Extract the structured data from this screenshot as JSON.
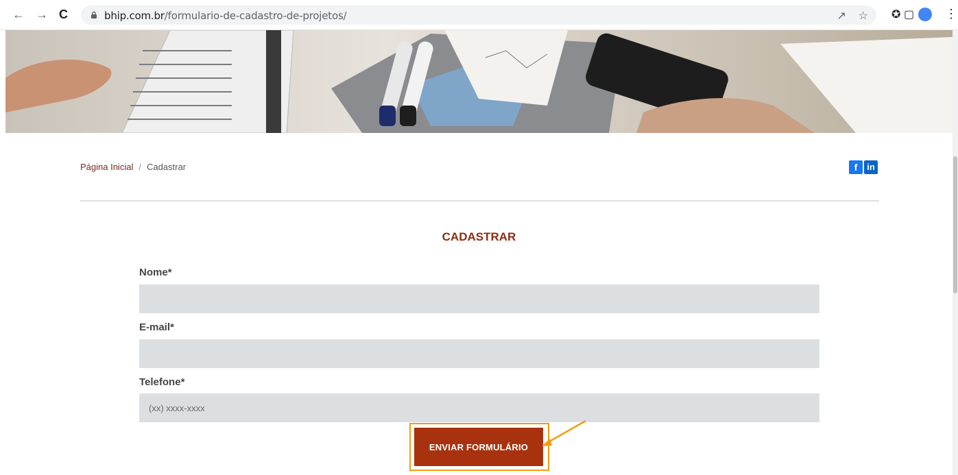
{
  "browser": {
    "url_host": "bhip.com.br",
    "url_path": "/formulario-de-cadastro-de-projetos/",
    "back_icon": "back-arrow-icon",
    "forward_icon": "forward-arrow-icon",
    "reload_icon": "reload-icon"
  },
  "breadcrumb": {
    "home": "Página Inicial",
    "separator": "/",
    "current": "Cadastrar"
  },
  "social": {
    "facebook": "f",
    "linkedin": "in"
  },
  "form": {
    "title": "CADASTRAR",
    "name_label": "Nome*",
    "name_value": "",
    "email_label": "E-mail*",
    "email_value": "",
    "phone_label": "Telefone*",
    "phone_placeholder": "(xx) xxxx-xxxx",
    "submit_label": "ENVIAR FORMULÁRIO"
  },
  "colors": {
    "accent": "#a8320e",
    "title": "#8b2e14",
    "highlight": "#f39c12",
    "field_bg": "#dcdfe2"
  }
}
